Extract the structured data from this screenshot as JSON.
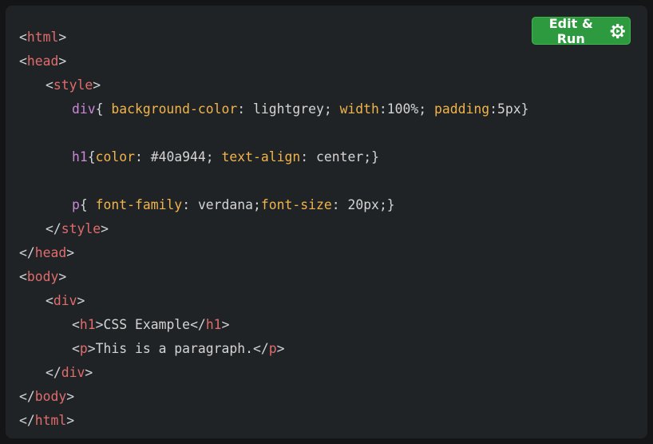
{
  "toolbar": {
    "run_label": "Edit & Run",
    "run_icon": "gear-run-icon",
    "button_color": "#2e9a3f"
  },
  "code": {
    "html_tag": "html",
    "head_tag": "head",
    "style_tag": "style",
    "body_tag": "body",
    "div_tag": "div",
    "h1_tag": "h1",
    "p_tag": "p",
    "css": {
      "div_selector": "div",
      "div_rule": [
        {
          "prop": "background-color",
          "value": "lightgrey"
        },
        {
          "prop": "width",
          "value": "100%"
        },
        {
          "prop": "padding",
          "value": "5px"
        }
      ],
      "h1_selector": "h1",
      "h1_rule": [
        {
          "prop": "color",
          "value": "#40a944"
        },
        {
          "prop": "text-align",
          "value": "center"
        }
      ],
      "p_selector": "p",
      "p_rule": [
        {
          "prop": "font-family",
          "value": "verdana"
        },
        {
          "prop": "font-size",
          "value": "20px"
        }
      ]
    },
    "h1_text": "CSS Example",
    "p_text": "This is a paragraph."
  },
  "colors": {
    "background": "#202326",
    "tag": "#e06c6c",
    "selector": "#c987d6",
    "property": "#f0b44a"
  }
}
